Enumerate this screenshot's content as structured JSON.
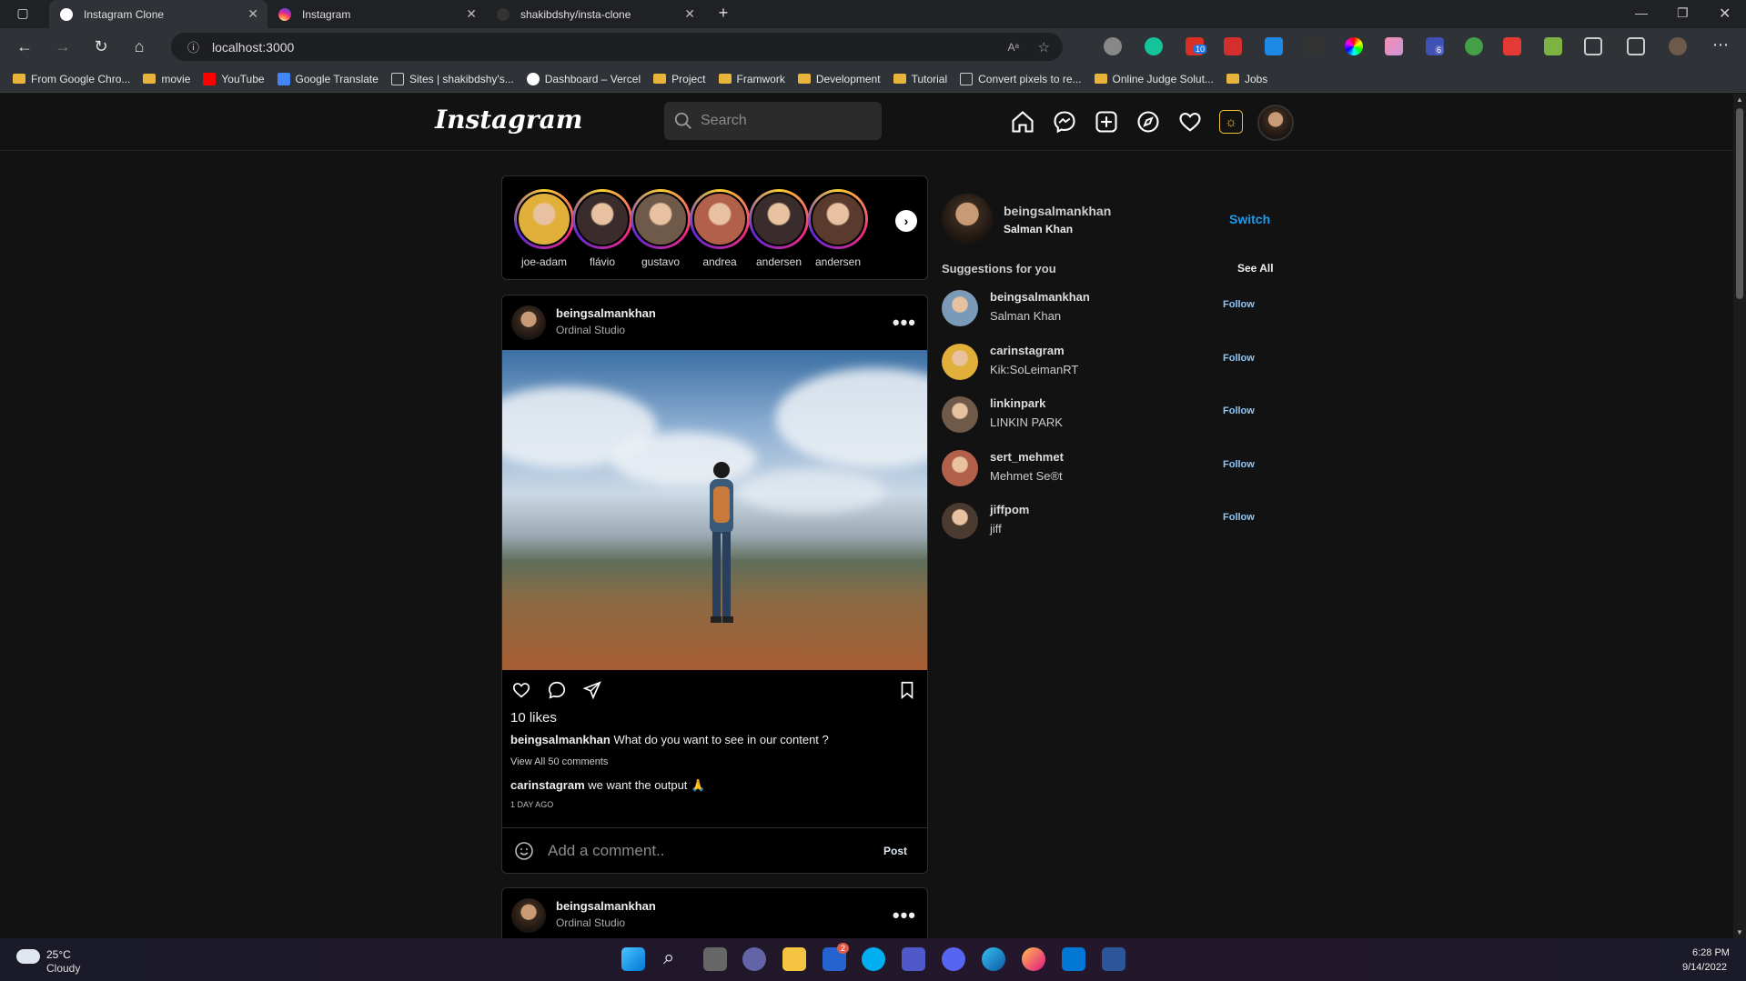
{
  "browser": {
    "tabs": [
      {
        "title": "Instagram Clone",
        "active": true
      },
      {
        "title": "Instagram",
        "active": false
      },
      {
        "title": "shakibdshy/insta-clone",
        "active": false
      }
    ],
    "address": "localhost:3000",
    "bookmarks": [
      "From Google Chro...",
      "movie",
      "YouTube",
      "Google Translate",
      "Sites | shakibdshy's...",
      "Dashboard – Vercel",
      "Project",
      "Framwork",
      "Development",
      "Tutorial",
      "Convert pixels to re...",
      "Online Judge Solut...",
      "Jobs"
    ],
    "ext_badges": {
      "grammarly_count": "10",
      "ext_count": "6"
    }
  },
  "app": {
    "logo": "Instagram",
    "search_placeholder": "Search",
    "nav_icons": [
      "home-icon",
      "messenger-icon",
      "new-post-icon",
      "explore-icon",
      "heart-icon",
      "theme-toggle-icon",
      "profile-avatar"
    ]
  },
  "stories": [
    {
      "name": "joe-adam",
      "color": "#e0b03a"
    },
    {
      "name": "flávio",
      "color": "#3a2c2c"
    },
    {
      "name": "gustavo",
      "color": "#6f5a4a"
    },
    {
      "name": "andrea",
      "color": "#b3604a"
    },
    {
      "name": "andersen",
      "color": "#3a2c2c"
    },
    {
      "name": "andersen",
      "color": "#5a3a2c"
    }
  ],
  "posts": [
    {
      "username": "beingsalmankhan",
      "location": "Ordinal Studio",
      "likes": "10 likes",
      "caption_user": "beingsalmankhan",
      "caption": "What do you want to see in our content ?",
      "view_all": "View All 50 comments",
      "comment_user": "carinstagram",
      "comment": "we want the output 🙏",
      "ago": "1 DAY AGO",
      "comment_placeholder": "Add a comment..",
      "post_label": "Post"
    },
    {
      "username": "beingsalmankhan",
      "location": "Ordinal Studio"
    }
  ],
  "sidebar": {
    "me": {
      "username": "beingsalmankhan",
      "name": "Salman Khan",
      "switch": "Switch"
    },
    "suggestions_title": "Suggestions for you",
    "see_all": "See All",
    "suggestions": [
      {
        "username": "beingsalmankhan",
        "name": "Salman Khan",
        "follow": "Follow",
        "color": "#7a9ab8"
      },
      {
        "username": "carinstagram",
        "name": "Kik:SoLeimanRT",
        "follow": "Follow",
        "color": "#e0b03a"
      },
      {
        "username": "linkinpark",
        "name": "LINKIN PARK",
        "follow": "Follow",
        "color": "#6f5a4a"
      },
      {
        "username": "sert_mehmet",
        "name": "Mehmet Se®t",
        "follow": "Follow",
        "color": "#b3604a"
      },
      {
        "username": "jiffpom",
        "name": "jiff",
        "follow": "Follow",
        "color": "#4a3a30"
      }
    ]
  },
  "taskbar": {
    "weather_temp": "25°C",
    "weather_desc": "Cloudy",
    "time": "6:28 PM",
    "date": "9/14/2022",
    "badge_count": "2"
  }
}
